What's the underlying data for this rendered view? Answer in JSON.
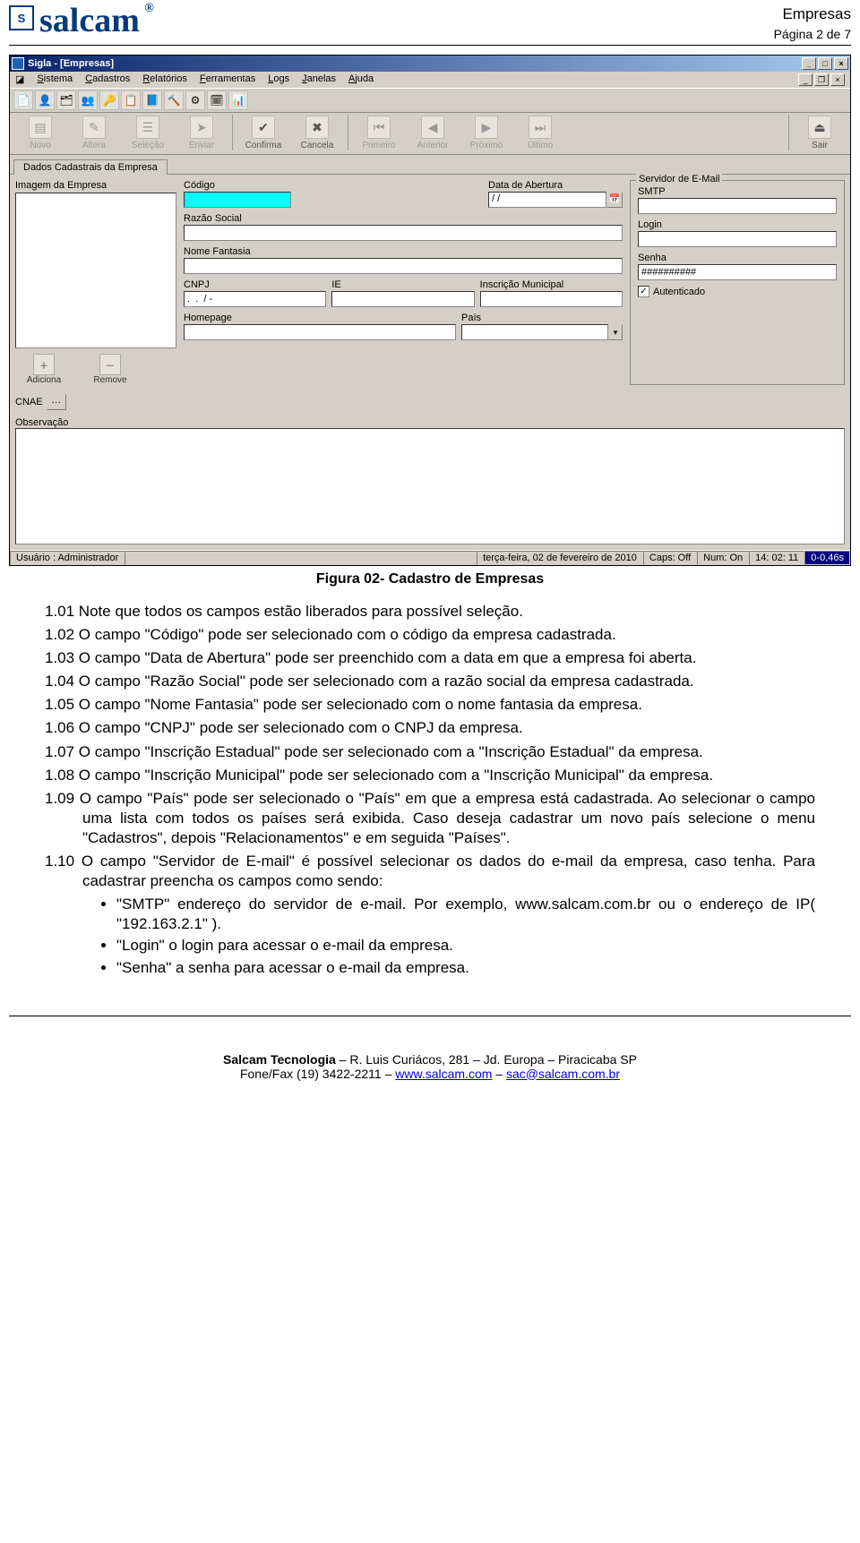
{
  "header": {
    "brand": "salcam",
    "brand_symbol": "®",
    "title": "Empresas",
    "page_indicator": "Página 2 de 7"
  },
  "app": {
    "window_title": "Sigla - [Empresas]",
    "menus": [
      "Sistema",
      "Cadastros",
      "Relatórios",
      "Ferramentas",
      "Logs",
      "Janelas",
      "Ajuda"
    ],
    "toolbar": {
      "novo": "Novo",
      "altera": "Altera",
      "selecao": "Seleção",
      "enviar": "Enviar",
      "confirma": "Confirma",
      "cancela": "Cancela",
      "primeiro": "Primeiro",
      "anterior": "Anterior",
      "proximo": "Próximo",
      "ultimo": "Último",
      "sair": "Sair"
    },
    "tab_label": "Dados Cadastrais da Empresa",
    "imagem_label": "Imagem da Empresa",
    "img_btn_add": "Adiciona",
    "img_btn_remove": "Remove",
    "fields": {
      "codigo": "Código",
      "data_abertura": "Data de Abertura",
      "data_val": "/  /",
      "razao": "Razão Social",
      "fantasia": "Nome Fantasia",
      "cnpj": "CNPJ",
      "cnpj_val": ".  .  / -",
      "ie": "IE",
      "insc_mun": "Inscrição Municipal",
      "homepage": "Homepage",
      "pais": "País"
    },
    "email": {
      "legend": "Servidor de E-Mail",
      "smtp": "SMTP",
      "login": "Login",
      "senha": "Senha",
      "senha_val": "##########",
      "autenticado": "Autenticado"
    },
    "cnae": "CNAE",
    "obs": "Observação",
    "status": {
      "user": "Usuário : Administrador",
      "date": "terça-feira, 02 de fevereiro de 2010",
      "caps": "Caps: Off",
      "num": "Num: On",
      "clock": "14: 02: 11",
      "timer": "0-0,46s"
    }
  },
  "caption": "Figura 02- Cadastro de Empresas",
  "items": {
    "i101": "1.01  Note que todos os campos estão liberados para possível seleção.",
    "i102": "1.02  O campo \"Código\" pode ser selecionado com o código da empresa cadastrada.",
    "i103": "1.03  O campo \"Data de Abertura\" pode ser preenchido com a data em que a empresa foi aberta.",
    "i104": "1.04  O campo \"Razão Social\" pode ser selecionado com a razão social da empresa cadastrada.",
    "i105": "1.05  O campo \"Nome Fantasia\" pode ser selecionado com o nome fantasia da empresa.",
    "i106": "1.06  O campo \"CNPJ\" pode ser selecionado com o CNPJ da empresa.",
    "i107": "1.07  O campo \"Inscrição Estadual\" pode ser selecionado com a \"Inscrição Estadual\" da empresa.",
    "i108": "1.08  O campo \"Inscrição Municipal\" pode ser selecionado com a \"Inscrição Municipal\" da empresa.",
    "i109": "1.09  O campo \"País\" pode ser selecionado o \"País\" em que a empresa está cadastrada. Ao selecionar o campo uma lista com todos os países será exibida. Caso deseja cadastrar um novo país selecione o menu \"Cadastros\", depois \"Relacionamentos\" e em seguida \"Países\".",
    "i110": "1.10  O campo \"Servidor de E-mail\" é possível selecionar os dados do e-mail da empresa, caso tenha. Para cadastrar preencha os campos como sendo:"
  },
  "bullets": {
    "b1": "\"SMTP\" endereço do servidor de e-mail. Por exemplo, www.salcam.com.br ou o endereço de IP( \"192.163.2.1\" ).",
    "b2": "\"Login\" o login para acessar o e-mail da empresa.",
    "b3": "\"Senha\" a senha para acessar o e-mail da empresa."
  },
  "footer": {
    "line1a": "Salcam Tecnologia",
    "line1b": " – R. Luis Curiácos, 281 – Jd. Europa – Piracicaba SP",
    "line2_prefix": "Fone/Fax (19) 3422-2211 – ",
    "link1": "www.salcam.com",
    "sep": " – ",
    "link2": "sac@salcam.com.br"
  }
}
